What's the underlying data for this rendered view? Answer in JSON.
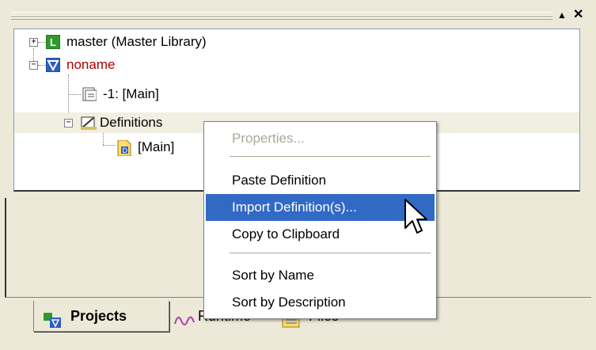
{
  "titlebar": {
    "float_glyph": "▲",
    "close_glyph": "✕"
  },
  "tree": {
    "items": [
      {
        "label": "master (Master Library)",
        "expander": "+",
        "color": "#000000"
      },
      {
        "label": "noname",
        "expander": "−",
        "color": "#b00000"
      },
      {
        "label": "-1: [Main]"
      },
      {
        "label": "Definitions",
        "expander": "−"
      },
      {
        "label": "[Main]"
      }
    ]
  },
  "menu": {
    "items": [
      {
        "label": "Properties...",
        "enabled": false
      },
      {
        "label": "Paste Definition",
        "enabled": true
      },
      {
        "label": "Import Definition(s)...",
        "enabled": true,
        "highlighted": true
      },
      {
        "label": "Copy to Clipboard",
        "enabled": true
      },
      {
        "label": "Sort by Name",
        "enabled": true
      },
      {
        "label": "Sort by Description",
        "enabled": true
      }
    ]
  },
  "tabs": [
    {
      "label": "Projects",
      "active": true
    },
    {
      "label": "Runtime",
      "active": false
    },
    {
      "label": "Files",
      "active": false
    }
  ],
  "colors": {
    "highlight": "#316ac5",
    "panel": "#ece9d8",
    "library_icon": "#2e9a2e",
    "project_icon": "#2b5fc0"
  }
}
